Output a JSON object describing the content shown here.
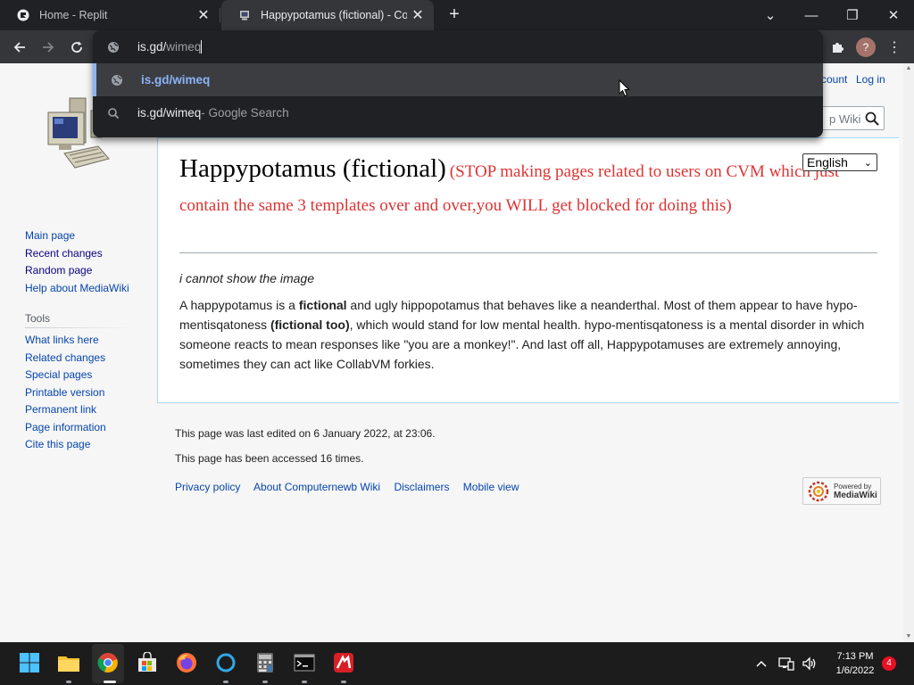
{
  "browser": {
    "tabs": [
      {
        "title": "Home - Replit",
        "icon": "replit-icon"
      },
      {
        "title": "Happypotamus (fictional) - Comp",
        "icon": "computernewb-icon"
      }
    ],
    "new_tab": "+",
    "window_controls": {
      "search_tabs": "⌄",
      "minimize": "—",
      "restore": "❐",
      "close": "✕"
    },
    "omnibox": {
      "typed": "is.gd/",
      "autocomplete": "wimeq",
      "suggestions": [
        {
          "text": "is.gd/wimeq",
          "icon": "globe-icon"
        },
        {
          "text": "is.gd/wimeq",
          "suffix": " - Google Search",
          "icon": "search-icon"
        }
      ]
    },
    "profile_letter": "?"
  },
  "wiki": {
    "top_links": {
      "account": "count",
      "login": "Log in"
    },
    "search_placeholder": "p Wiki",
    "language": "English",
    "title": "Happypotamus (fictional)",
    "title_note": "(STOP making pages related to users on CVM which just contain the same 3 templates over and over,you WILL get blocked for doing this)",
    "image_note": "i cannot show the image",
    "body": {
      "p1": "A happypotamus is a ",
      "b1": "fictional",
      "p2": " and ugly hippopotamus that behaves like a neanderthal. Most of them appear to have hypo-mentisqatoness ",
      "b2": "(fictional too)",
      "p3": ", which would stand for low mental health. hypo-mentisqatoness is a mental disorder in which someone reacts to mean responses like \"you are a monkey!\". And last off all, Happypotamuses are extremely annoying, sometimes they can act like CollabVM forkies."
    },
    "nav": [
      "Main page",
      "Recent changes",
      "Random page",
      "Help about MediaWiki"
    ],
    "tools_heading": "Tools",
    "tools": [
      "What links here",
      "Related changes",
      "Special pages",
      "Printable version",
      "Permanent link",
      "Page information",
      "Cite this page"
    ],
    "footer": {
      "last_edited": "This page was last edited on 6 January 2022, at 23:06.",
      "accessed": "This page has been accessed 16 times.",
      "links": [
        "Privacy policy",
        "About Computernewb Wiki",
        "Disclaimers",
        "Mobile view"
      ],
      "powered_1": "Powered by",
      "powered_2": "MediaWiki"
    }
  },
  "taskbar": {
    "time": "7:13 PM",
    "date": "1/6/2022",
    "notifications": "4"
  },
  "colors": {
    "link": "#0645ad",
    "warning": "#dd3333",
    "chrome_bg": "#202124",
    "accent": "#8ab4f8"
  }
}
